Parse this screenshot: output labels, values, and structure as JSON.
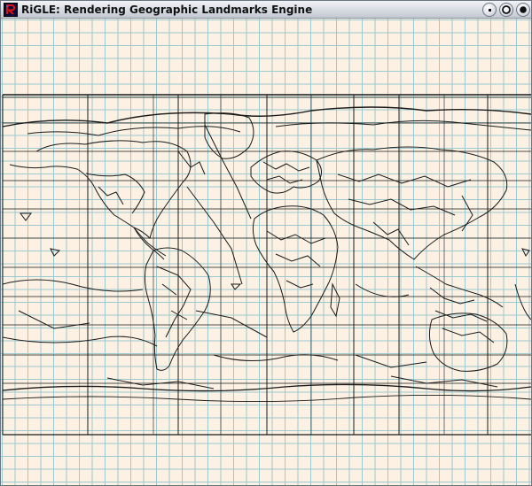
{
  "window": {
    "title": "RiGLE: Rendering Geographic Landmarks Engine",
    "icon": "rigle-logo-icon",
    "buttons": [
      "minimize-icon",
      "maximize-icon",
      "close-icon"
    ]
  },
  "colors": {
    "background": "#fcf1e2",
    "grid": "#9cc9d0",
    "lines": "#1a1a1a",
    "titlebar": "#d7dbe2",
    "logo_bg": "#0b0b3a",
    "logo_letter": "#e01010"
  }
}
